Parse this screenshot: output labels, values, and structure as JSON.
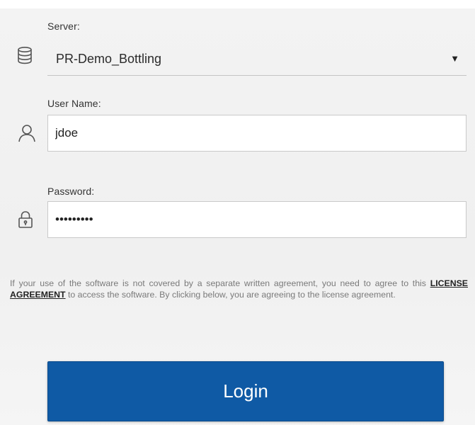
{
  "server": {
    "label": "Server:",
    "value": "PR-Demo_Bottling",
    "caret": "▼",
    "icon": "database-icon"
  },
  "username": {
    "label": "User Name:",
    "value": "jdoe",
    "icon": "user-icon"
  },
  "password": {
    "label": "Password:",
    "value": "123456789",
    "icon": "lock-icon"
  },
  "license": {
    "text_before": "If your use of the software is not covered by a separate written agreement, you need to agree to this ",
    "link_text": "LICENSE AGREEMENT",
    "text_after": " to access the software. By clicking below, you are agreeing to the license agreement."
  },
  "login": {
    "label": "Login"
  },
  "colors": {
    "button": "#0f5aa5",
    "panel": "#f1f1f1"
  }
}
